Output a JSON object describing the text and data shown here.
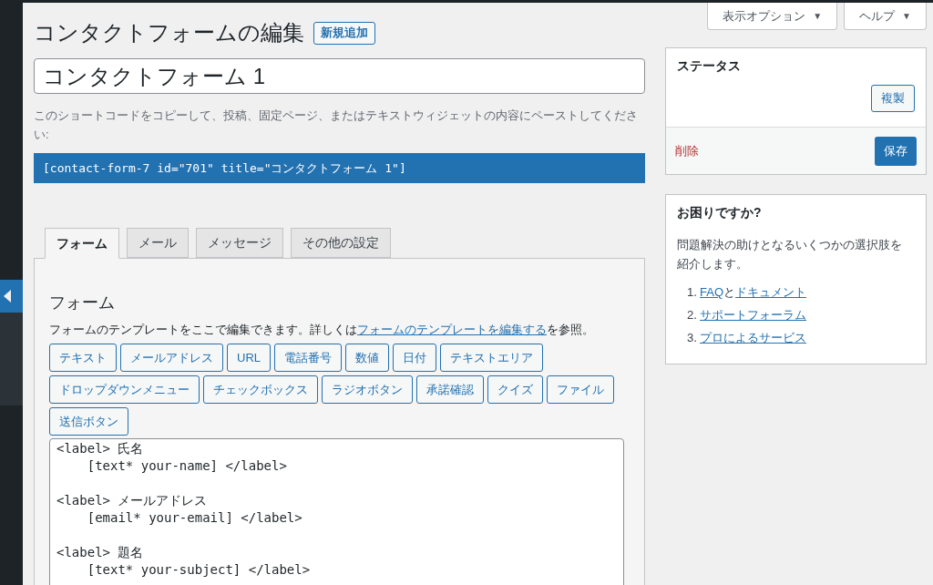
{
  "screen_options": [
    {
      "label": "表示オプション",
      "caret": "▼"
    },
    {
      "label": "ヘルプ",
      "caret": "▼"
    }
  ],
  "header": {
    "title": "コンタクトフォームの編集",
    "add_new": "新規追加"
  },
  "form_title": {
    "value": "コンタクトフォーム 1"
  },
  "shortcode": {
    "hint": "このショートコードをコピーして、投稿、固定ページ、またはテキストウィジェットの内容にペーストしてください:",
    "code": "[contact-form-7 id=\"701\" title=\"コンタクトフォーム 1\"]"
  },
  "tabs": [
    {
      "label": "フォーム",
      "selected": true
    },
    {
      "label": "メール",
      "selected": false
    },
    {
      "label": "メッセージ",
      "selected": false
    },
    {
      "label": "その他の設定",
      "selected": false
    }
  ],
  "panel": {
    "heading": "フォーム",
    "description": {
      "before": "フォームのテンプレートをここで編集できます。詳しくは",
      "link": "フォームのテンプレートを編集する",
      "after": "を参照。"
    },
    "tag_buttons": [
      [
        "テキスト",
        "メールアドレス",
        "URL",
        "電話番号",
        "数値",
        "日付",
        "テキストエリア"
      ],
      [
        "ドロップダウンメニュー",
        "チェックボックス",
        "ラジオボタン",
        "承諾確認",
        "クイズ",
        "ファイル"
      ],
      [
        "送信ボタン"
      ]
    ],
    "code_blocks": [
      [
        "<label> 氏名",
        "    [text* your-name] </label>"
      ],
      [
        "<label> メールアドレス",
        "    [email* your-email] </label>"
      ],
      [
        "<label> 題名",
        "    [text* your-subject] </label>"
      ]
    ]
  },
  "status_box": {
    "title": "ステータス",
    "duplicate": "複製",
    "delete": "削除",
    "save": "保存"
  },
  "help_box": {
    "title": "お困りですか?",
    "text": "問題解決の助けとなるいくつかの選択肢を紹介します。",
    "items": [
      {
        "number": "1.",
        "links": [
          "FAQ",
          "ドキュメント"
        ],
        "joiner": "と"
      },
      {
        "number": "2.",
        "links": [
          "サポートフォーラム"
        ]
      },
      {
        "number": "3.",
        "links": [
          "プロによるサービス"
        ]
      }
    ]
  }
}
